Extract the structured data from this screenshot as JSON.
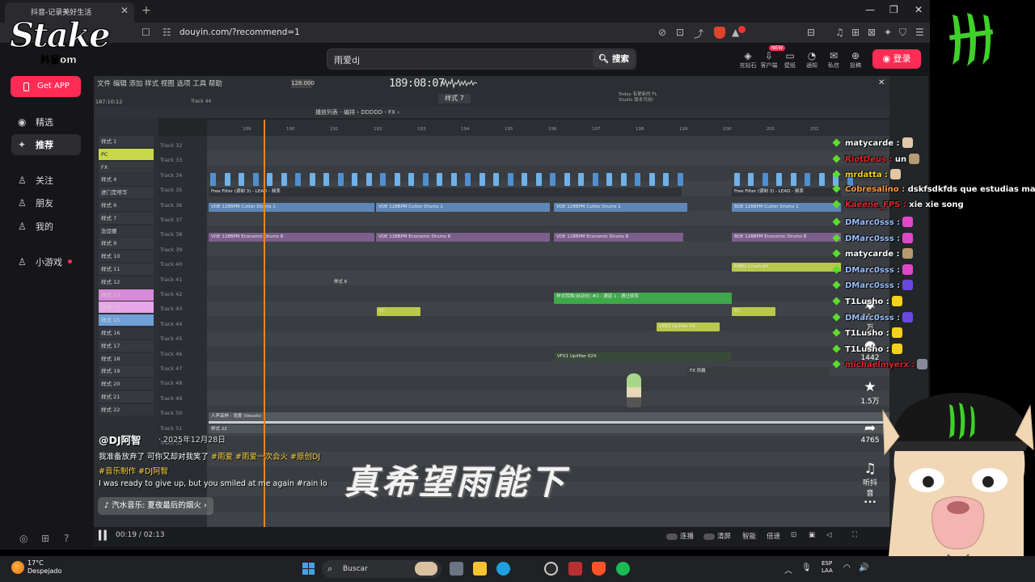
{
  "browser": {
    "tab_title": "抖音-记录美好生活",
    "tab_close": "✕",
    "new_tab": "+",
    "url": "douyin.com/?recommend=1",
    "window_controls": [
      "—",
      "❐",
      "✕"
    ],
    "address_icons": [
      "☐",
      "⟳",
      "☷"
    ],
    "right_icons": [
      "⊘",
      "⊡",
      "⤴",
      "☆",
      "⊟",
      "♫",
      "⊞",
      "⊠",
      "✦",
      "⛉",
      "☰"
    ]
  },
  "watermark": {
    "brand": "Stake",
    "platform": "抖音"
  },
  "header": {
    "search_value": "雨爱dj",
    "search_button": "搜索",
    "topics": [
      {
        "icon": "◈",
        "label": "充钻石"
      },
      {
        "icon": "⇩",
        "label": "客户端"
      },
      {
        "icon": "▭",
        "label": "壁纸"
      },
      {
        "icon": "◔",
        "label": "通知"
      },
      {
        "icon": "✉",
        "label": "私信"
      },
      {
        "icon": "⊕",
        "label": "投稿"
      }
    ],
    "new_badge": "NEW",
    "login_label": "登录"
  },
  "sidebar": {
    "get_app": "Get APP",
    "items": [
      {
        "icon": "◉",
        "label": "精选"
      },
      {
        "icon": "✦",
        "label": "推荐"
      },
      {
        "icon": "♙",
        "label": "关注"
      },
      {
        "icon": "♙",
        "label": "朋友"
      },
      {
        "icon": "♙",
        "label": "我的"
      },
      {
        "icon": "♙",
        "label": "小游戏"
      }
    ],
    "bottom_icons": [
      "◎",
      "⊞",
      "?"
    ]
  },
  "fl": {
    "menu": "文件 编辑 添加 样式 视图 选项 工具 帮助",
    "tempo": "128.000",
    "time": "189:08:07",
    "time_small": "187:10:12",
    "track_label": "Track 44",
    "pattern": "样式 7",
    "tips": "Today 有更新的 FL\nStudio 版本可用!",
    "breadcrumb": "播放列表 - 编排 › DDDDD - FX ›",
    "patterns": [
      "样式 1",
      "PC",
      "FX",
      "样式 4",
      "进门是啥写",
      "样式 6",
      "样式 7",
      "急促腰",
      "样式 9",
      "样式 10",
      "样式 11",
      "样式 12",
      "样式 13",
      "样式 14",
      "样式 15",
      "样式 16",
      "样式 17",
      "样式 18",
      "样式 19",
      "样式 20",
      "样式 21",
      "样式 22"
    ],
    "tracks": [
      "Track 32",
      "Track 33",
      "Track 34",
      "Track 35",
      "Track 36",
      "Track 37",
      "Track 38",
      "Track 39",
      "Track 40",
      "Track 41",
      "Track 42",
      "Track 43",
      "Track 44",
      "Track 45",
      "Track 46",
      "Track 47",
      "Track 48",
      "Track 49",
      "Track 50",
      "Track 51",
      "Track 52"
    ],
    "ruler": [
      "189",
      "190",
      "191",
      "192",
      "193",
      "194",
      "195",
      "196",
      "197",
      "198",
      "199",
      "200",
      "201",
      "202"
    ],
    "clips": {
      "free_filter": "Free Filter (调制 3) - LEAD - 频率",
      "free_filter_b": "Free Filter (调制 3) - LEAD - 频率",
      "cutter": "VOE 128BPM Cutter Drums 1",
      "cutter_b": "VOE 128BPM Cutter Drums 1",
      "cutter_c": "VOE 128BPM Cutter Drums 1",
      "cutter_d": "BOE 128BPM Cutter Drums 1",
      "economic": "VOE 128BPM Economic Drums 8",
      "economic_b": "VOE 128BPM Economic Drums 8",
      "economic_c": "VOE 128BPM Economic Drums 8",
      "economic_d": "BOE 128BPM Economic Drums 8",
      "crash": "EMB2 Crash 04",
      "style6": "样式 6",
      "transition": "样式转换(自动化) #2 - 通道 1 - 通过频率",
      "pc": "PC",
      "pc_b": "PC",
      "uplifter": "VEE3 Uplifter 04",
      "vfx": "VFX1 Uplifter 024",
      "reverse": "FX 风格",
      "vocals": "人声采样 - 雨爱 (Vocals)",
      "vocals_b": "样式 22"
    }
  },
  "video": {
    "author": "@DJ阿智",
    "date": "· 2025年12月28日",
    "desc_text": "我准备放弃了 可你又却对我笑了",
    "desc_tags": " #雨爱  #雨爱一次会火  #原创DJ",
    "tags": "#音乐制作  #DJ阿智",
    "en_desc": "I was ready to give up, but you smiled at me again #rain lo",
    "music": "♪ 汽水音乐: 夏夜最后的烟火 ›",
    "subtitle": "真希望雨能下",
    "time": "00:19 / 02:13",
    "controls": {
      "lianbo": "连播",
      "qingping": "清屏",
      "zhineng": "智能",
      "beisu": "倍速"
    },
    "actions": [
      {
        "icon": "♥",
        "count": "10.0万"
      },
      {
        "icon": "●",
        "count": "1442"
      },
      {
        "icon": "★",
        "count": "1.5万"
      },
      {
        "icon": "➦",
        "count": "4765"
      },
      {
        "icon": "♫",
        "count": "听抖音"
      },
      {
        "icon": "•••",
        "count": ""
      }
    ],
    "nav_up": "︿"
  },
  "chat": [
    {
      "user": "matycarde :",
      "msg": "",
      "ucolor": "#ffffff",
      "emoji": "#e0c8a8"
    },
    {
      "user": "RiotDeus :",
      "msg": "un",
      "ucolor": "#e0242b",
      "emoji": "#b89a70"
    },
    {
      "user": "mrdatta :",
      "msg": "",
      "ucolor": "#f4d020",
      "emoji": "#e0c8a8"
    },
    {
      "user": "Cobresalino :",
      "msg": "dskfsdkfds que estudias manito",
      "ucolor": "#ff9a3c",
      "emoji": ""
    },
    {
      "user": "Kaeene_FPS :",
      "msg": "xie xie song",
      "ucolor": "#e0242b",
      "emoji": ""
    },
    {
      "user": "DMarc0sss :",
      "msg": "",
      "ucolor": "#9ac0ff",
      "emoji": "#e048c8"
    },
    {
      "user": "DMarc0sss :",
      "msg": "",
      "ucolor": "#9ac0ff",
      "emoji": "#e048c8"
    },
    {
      "user": "matycarde :",
      "msg": "",
      "ucolor": "#ffffff",
      "emoji": "#b89a70"
    },
    {
      "user": "DMarc0sss :",
      "msg": "",
      "ucolor": "#9ac0ff",
      "emoji": "#e048c8"
    },
    {
      "user": "DMarc0sss :",
      "msg": "",
      "ucolor": "#9ac0ff",
      "emoji": "#6a48e0"
    },
    {
      "user": "T1Lusho :",
      "msg": "",
      "ucolor": "#ffffff",
      "emoji": "#f4d020"
    },
    {
      "user": "DMarc0sss :",
      "msg": "",
      "ucolor": "#9ac0ff",
      "emoji": "#6a48e0"
    },
    {
      "user": "T1Lusho :",
      "msg": "",
      "ucolor": "#ffffff",
      "emoji": "#f4d020"
    },
    {
      "user": "T1Lusho :",
      "msg": "",
      "ucolor": "#ffffff",
      "emoji": "#f4d020"
    },
    {
      "user": "michaelmyerx :",
      "msg": "",
      "ucolor": "#e0242b",
      "emoji": "#8a8a9a"
    }
  ],
  "taskbar": {
    "temp": "17°C",
    "weather": "Despejado",
    "search": "Buscar",
    "lang1": "ESP",
    "lang2": "LAA",
    "tray": [
      "︿",
      "🎙",
      "◠",
      "🔊"
    ]
  },
  "colors": {
    "accent": "#fe2c55",
    "playhead": "#e8861d",
    "chat_badge": "#5cdc2e"
  }
}
